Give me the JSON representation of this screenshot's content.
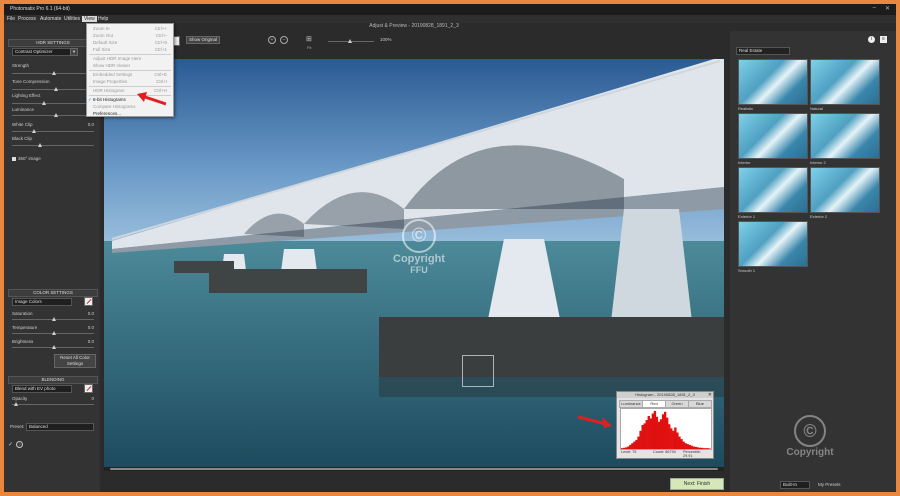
{
  "window": {
    "title": "Photomatix Pro 6.1 (64-bit)"
  },
  "menubar": {
    "items": [
      "File",
      "Process",
      "Automate",
      "Utilities",
      "View",
      "Help"
    ]
  },
  "document": {
    "title": "Adjust & Preview - 20190828_1891_2_3"
  },
  "left_panel": {
    "hdr_header": "HDR SETTINGS",
    "method": "Contrast Optimizer",
    "sliders": [
      {
        "label": "Strength",
        "value": ""
      },
      {
        "label": "Tone Compression",
        "value": ""
      },
      {
        "label": "Lighting Effect",
        "value": ""
      },
      {
        "label": "Luminance",
        "value": ""
      },
      {
        "label": "White Clip",
        "value": "0.0"
      },
      {
        "label": "Black Clip",
        "value": ""
      }
    ],
    "checkbox_360": "360° image",
    "color_header": "COLOR SETTINGS",
    "image_colors": "Image Colors",
    "color_sliders": [
      {
        "label": "Saturation",
        "value": "0.0"
      },
      {
        "label": "Temperature",
        "value": "0.0"
      },
      {
        "label": "Brightness",
        "value": "0.0"
      }
    ],
    "reset_button": "Reset All Color Settings",
    "blending_header": "BLENDING",
    "blend_mode": "Blend with EV photo",
    "opacity_label": "Opacity",
    "opacity_value": "0",
    "preset_label": "Preset:",
    "preset_value": "Balanced"
  },
  "toolbar": {
    "show_original": "Show Original",
    "zoom_value": "100%",
    "fit_label": "Fit"
  },
  "view_menu": {
    "items": [
      {
        "label": "Zoom In",
        "shortcut": "Ctrl++",
        "enabled": false
      },
      {
        "label": "Zoom Out",
        "shortcut": "Ctrl+-",
        "enabled": false
      },
      {
        "label": "Default Size",
        "shortcut": "Ctrl+0",
        "enabled": false
      },
      {
        "label": "Full Size",
        "shortcut": "Ctrl+1",
        "enabled": false
      },
      {
        "label": "Adjust HDR Image Here",
        "shortcut": "",
        "enabled": false
      },
      {
        "label": "Show HDR Viewer",
        "shortcut": "",
        "enabled": false
      },
      {
        "label": "Embedded Settings",
        "shortcut": "Ctrl+E",
        "enabled": false
      },
      {
        "label": "Image Properties",
        "shortcut": "Ctrl+I",
        "enabled": false
      },
      {
        "label": "HDR Histogram",
        "shortcut": "Ctrl+H",
        "enabled": false
      },
      {
        "label": "8-bit Histograms",
        "shortcut": "",
        "enabled": true
      },
      {
        "label": "Compare Histograms",
        "shortcut": "",
        "enabled": false
      },
      {
        "label": "Preferences...",
        "shortcut": "",
        "enabled": true
      }
    ]
  },
  "histogram": {
    "title": "Histogram - 20190828_1891_2_3",
    "tabs": [
      "Luminance",
      "Red",
      "Green",
      "Blue"
    ],
    "active_tab": "Red",
    "level": "Level: 75",
    "count": "Count: 86790",
    "percentile": "Percentile: 29.91",
    "bars": [
      2,
      3,
      4,
      6,
      10,
      14,
      18,
      22,
      30,
      44,
      58,
      62,
      70,
      80,
      74,
      86,
      92,
      78,
      66,
      72,
      84,
      90,
      76,
      60,
      50,
      44,
      52,
      40,
      30,
      24,
      18,
      14,
      12,
      10,
      8,
      6,
      5,
      4,
      3,
      3,
      2,
      2,
      2,
      1
    ]
  },
  "right_panel": {
    "category": "Real Estate",
    "presets": [
      "Realistic",
      "Natural",
      "Interior",
      "Interior 2",
      "Exterior 1",
      "Exterior 2",
      "Smooth 1"
    ]
  },
  "next_button": "Next: Finish",
  "watermark": {
    "line1": "Copyright",
    "line2": "FFU"
  },
  "bottom_right": {
    "select": "Built-In",
    "label": "My Presets"
  },
  "colors": {
    "accent": "#e8873d",
    "red_arrow": "#e02020",
    "histogram_red": "#e01010"
  }
}
